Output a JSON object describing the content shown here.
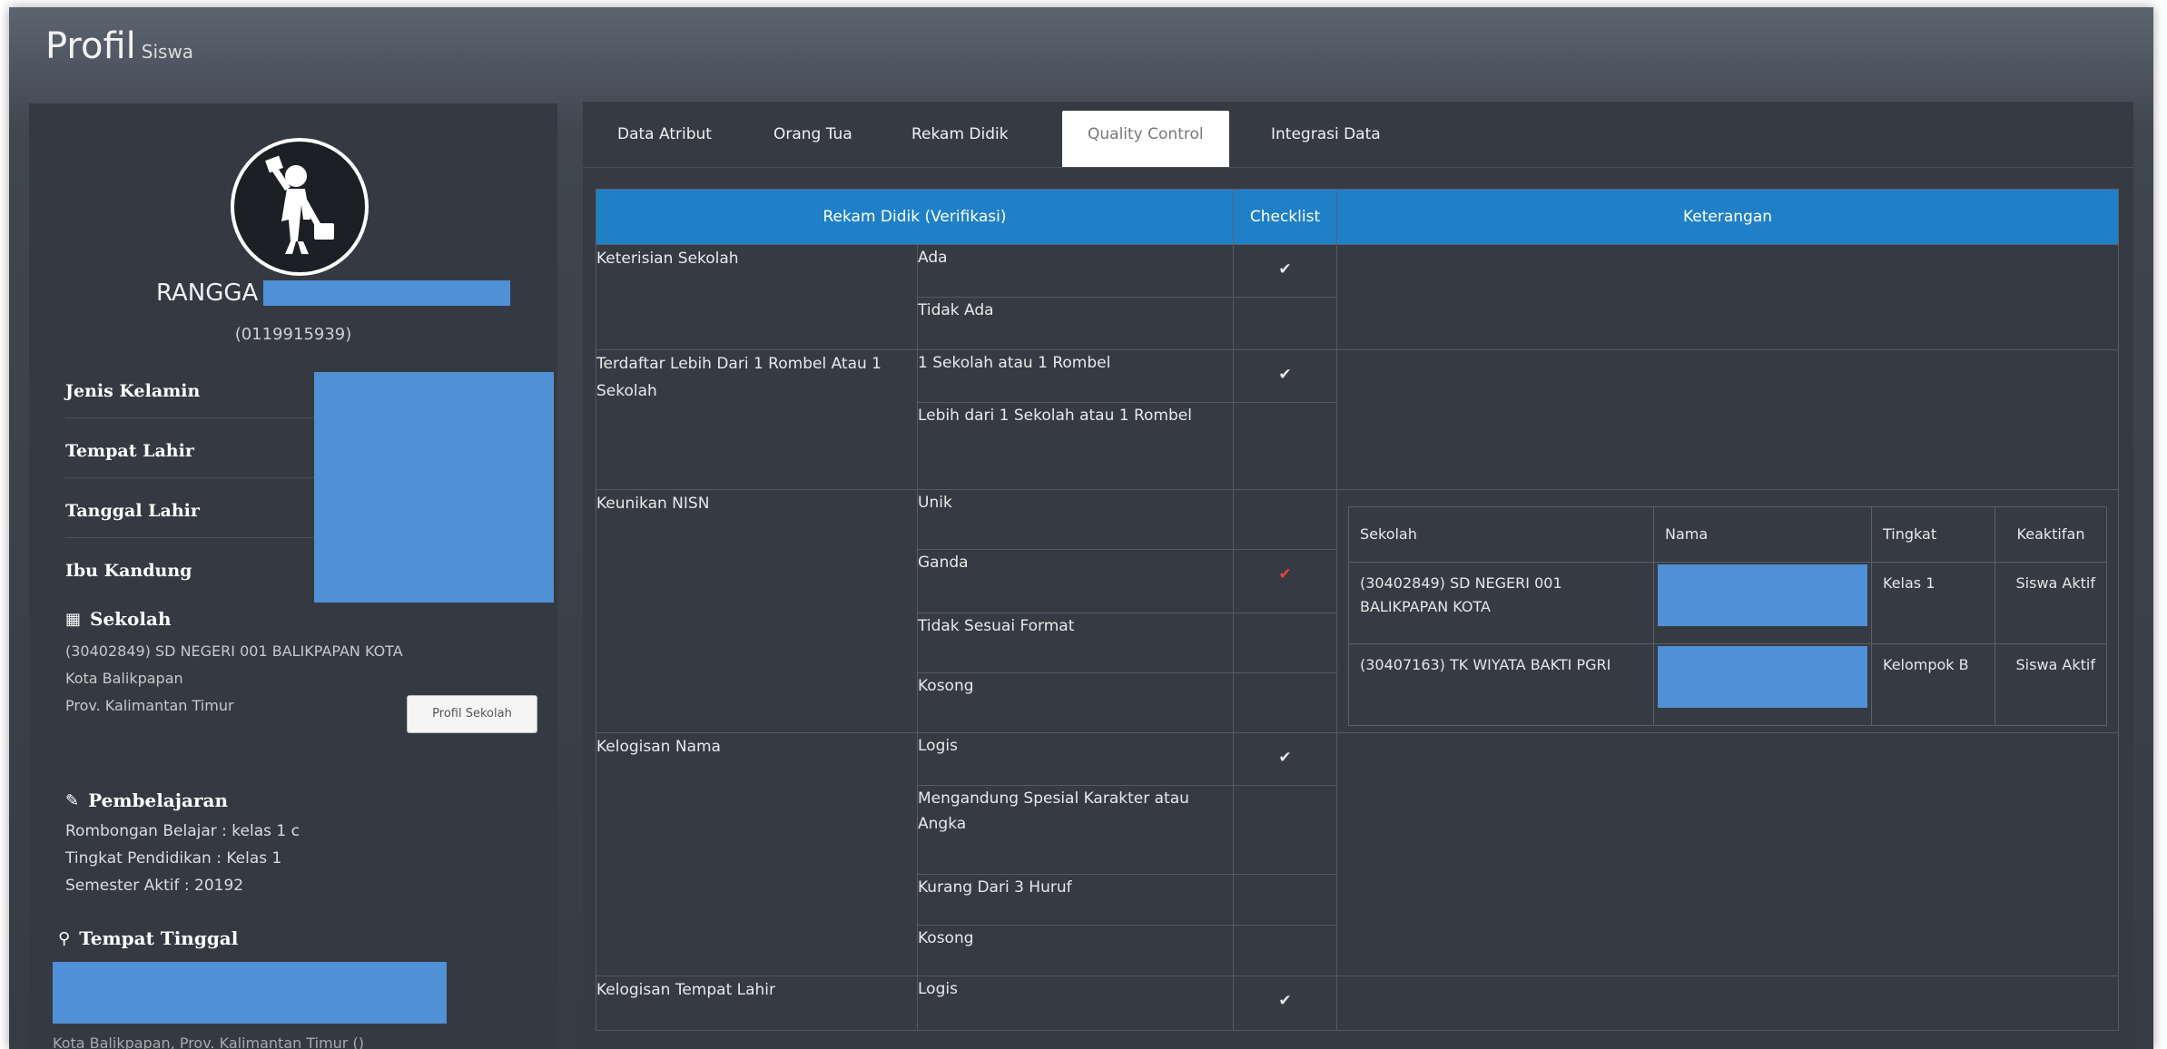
{
  "page": {
    "title": "Profil",
    "subtitle": "Siswa"
  },
  "profile": {
    "name": "RANGGA",
    "nisn": "(0119915939)",
    "fields": [
      "Jenis Kelamin",
      "Tempat Lahir",
      "Tanggal Lahir",
      "Ibu Kandung"
    ],
    "sekolah": {
      "heading": "Sekolah",
      "school": "(30402849) SD NEGERI 001 BALIKPAPAN KOTA",
      "city": "Kota Balikpapan",
      "province": "Prov. Kalimantan Timur",
      "button_label": "Profil Sekolah"
    },
    "pembelajaran": {
      "heading": "Pembelajaran",
      "rombel": "Rombongan Belajar : kelas 1 c",
      "tingkat": "Tingkat Pendidikan : Kelas 1",
      "semester": "Semester Aktif : 20192"
    },
    "tempat_tinggal": {
      "heading": "Tempat Tinggal",
      "address": "Kota Balikpapan, Prov. Kalimantan Timur ()"
    }
  },
  "tabs": [
    {
      "label": "Data Atribut",
      "active": false
    },
    {
      "label": "Orang Tua",
      "active": false
    },
    {
      "label": "Rekam Didik",
      "active": false
    },
    {
      "label": "Quality Control",
      "active": true
    },
    {
      "label": "Integrasi Data",
      "active": false
    }
  ],
  "qc_table": {
    "headers": [
      "Rekam Didik (Verifikasi)",
      "Checklist",
      "Keterangan"
    ],
    "groups": [
      {
        "category": "Keterisian Sekolah",
        "options": [
          {
            "label": "Ada",
            "check": "white"
          },
          {
            "label": "Tidak Ada",
            "check": ""
          }
        ]
      },
      {
        "category": "Terdaftar Lebih Dari 1 Rombel Atau 1 Sekolah",
        "options": [
          {
            "label": "1 Sekolah atau 1 Rombel",
            "check": "white"
          },
          {
            "label": "Lebih dari 1 Sekolah atau 1 Rombel",
            "check": ""
          }
        ]
      },
      {
        "category": "Keunikan NISN",
        "options": [
          {
            "label": "Unik",
            "check": ""
          },
          {
            "label": "Ganda",
            "check": "red"
          },
          {
            "label": "Tidak Sesuai Format",
            "check": ""
          },
          {
            "label": "Kosong",
            "check": ""
          }
        ]
      },
      {
        "category": "Kelogisan Nama",
        "options": [
          {
            "label": "Logis",
            "check": "white"
          },
          {
            "label": "Mengandung Spesial Karakter atau Angka",
            "check": ""
          },
          {
            "label": "Kurang Dari 3 Huruf",
            "check": ""
          },
          {
            "label": "Kosong",
            "check": ""
          }
        ]
      },
      {
        "category": "Kelogisan Tempat Lahir",
        "options": [
          {
            "label": "Logis",
            "check": "white"
          }
        ]
      }
    ],
    "check_glyph": "✔",
    "nisn_detail": {
      "headers": [
        "Sekolah",
        "Nama",
        "Tingkat",
        "Keaktifan"
      ],
      "rows": [
        {
          "sekolah": "(30402849) SD NEGERI 001 BALIKPAPAN KOTA",
          "tingkat": "Kelas 1",
          "keaktifan": "Siswa Aktif"
        },
        {
          "sekolah": "(30407163) TK WIYATA BAKTI PGRI",
          "tingkat": "Kelompok B",
          "keaktifan": "Siswa Aktif"
        }
      ]
    }
  },
  "colors": {
    "header_blue": "#1f80c8",
    "redaction_blue": "#4f90d6",
    "check_red": "#e0453b",
    "panel": "#363b43"
  }
}
